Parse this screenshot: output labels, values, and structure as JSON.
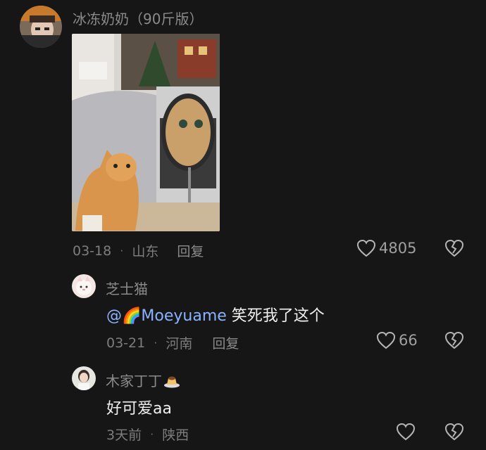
{
  "main_comment": {
    "username": "冰冻奶奶（90斤版）",
    "date": "03-18",
    "location": "山东",
    "reply_label": "回复",
    "like_count": "4805"
  },
  "reply_1": {
    "username": "芝士猫",
    "mention": "@🌈Moeyuame",
    "text": "笑死我了这个",
    "date": "03-21",
    "location": "河南",
    "reply_label": "回复",
    "like_count": "66"
  },
  "reply_2": {
    "username": "木家丁丁",
    "text": "好可爱aa",
    "date": "3天前",
    "location": "陕西"
  },
  "icons": {
    "like": "heart-outline-icon",
    "dislike": "broken-heart-icon"
  },
  "colors": {
    "background": "#161616",
    "mention": "#8ab3ff"
  }
}
